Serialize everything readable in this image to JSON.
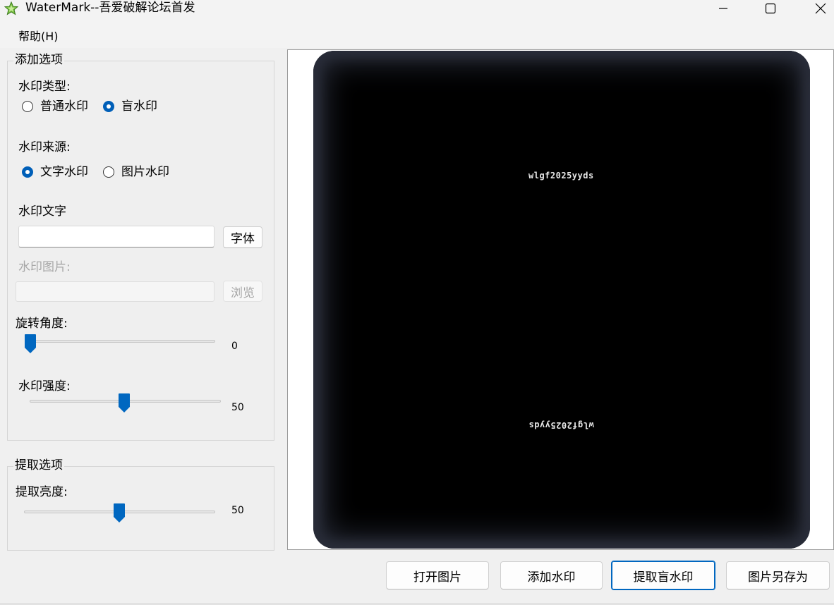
{
  "window": {
    "title": "WaterMark--吾爱破解论坛首发",
    "controls": [
      "minimize-icon",
      "maximize-icon",
      "close-icon"
    ]
  },
  "menu": {
    "help": "帮助(H)"
  },
  "add_options": {
    "legend": "添加选项",
    "type_label": "水印类型:",
    "type_options": [
      {
        "label": "普通水印",
        "checked": false
      },
      {
        "label": "盲水印",
        "checked": true
      }
    ],
    "source_label": "水印来源:",
    "source_options": [
      {
        "label": "文字水印",
        "checked": true
      },
      {
        "label": "图片水印",
        "checked": false
      }
    ],
    "text_label": "水印文字",
    "text_value": "",
    "font_button": "字体",
    "image_label": "水印图片:",
    "image_value": "",
    "browse_button": "浏览",
    "rotation_label": "旋转角度:",
    "rotation_value": "0",
    "strength_label": "水印强度:",
    "strength_value": "50"
  },
  "extract_options": {
    "legend": "提取选项",
    "brightness_label": "提取亮度:",
    "brightness_value": "50"
  },
  "preview": {
    "watermark_text_top": "wlgf2025yyds",
    "watermark_text_bottom": "wlgf2025yyds"
  },
  "buttons": {
    "open": "打开图片",
    "add": "添加水印",
    "extract": "提取盲水印",
    "save_as": "图片另存为"
  },
  "colors": {
    "accent": "#005fb8",
    "thumb": "#0067c0"
  }
}
